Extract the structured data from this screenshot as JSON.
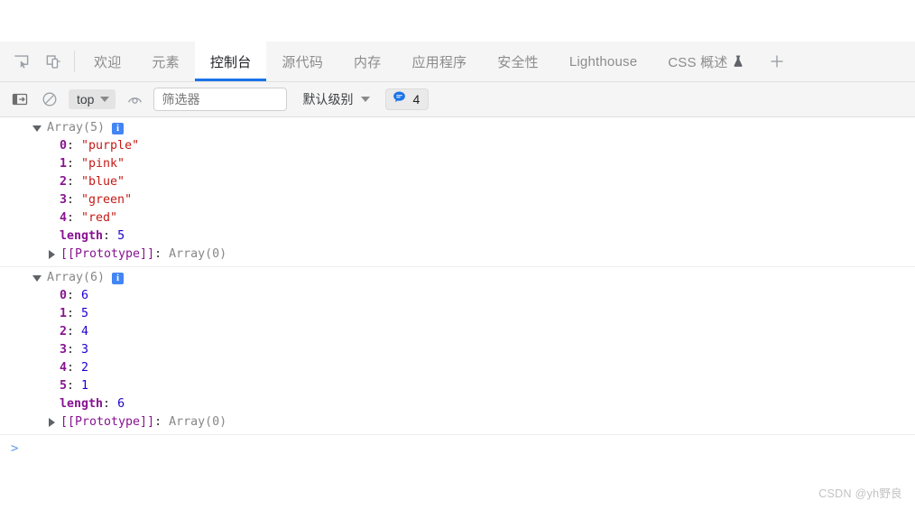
{
  "window": {
    "watermark": "CSDN @yh野良"
  },
  "tabbar": {
    "inspect_icon": "inspect-element-icon",
    "device_icon": "device-toolbar-icon",
    "add_label": "+",
    "tabs": [
      {
        "label": "欢迎",
        "active": false,
        "flask": false
      },
      {
        "label": "元素",
        "active": false,
        "flask": false
      },
      {
        "label": "控制台",
        "active": true,
        "flask": false
      },
      {
        "label": "源代码",
        "active": false,
        "flask": false
      },
      {
        "label": "内存",
        "active": false,
        "flask": false
      },
      {
        "label": "应用程序",
        "active": false,
        "flask": false
      },
      {
        "label": "安全性",
        "active": false,
        "flask": false
      },
      {
        "label": "Lighthouse",
        "active": false,
        "flask": false
      },
      {
        "label": "CSS 概述",
        "active": false,
        "flask": true
      }
    ]
  },
  "console_toolbar": {
    "sidebar_icon": "show-console-sidebar-icon",
    "clear_icon": "clear-console-icon",
    "context": "top",
    "eye_icon": "live-expression-eye-icon",
    "filter_placeholder": "筛选器",
    "filter_value": "",
    "level": "默认级别",
    "message_icon": "message-bubble-icon",
    "message_count": "4"
  },
  "console": {
    "groups": [
      {
        "header": "Array(5)",
        "info_badge": "i",
        "props": [
          {
            "key": "0",
            "value": "\"purple\"",
            "type": "string"
          },
          {
            "key": "1",
            "value": "\"pink\"",
            "type": "string"
          },
          {
            "key": "2",
            "value": "\"blue\"",
            "type": "string"
          },
          {
            "key": "3",
            "value": "\"green\"",
            "type": "string"
          },
          {
            "key": "4",
            "value": "\"red\"",
            "type": "string"
          },
          {
            "key": "length",
            "value": "5",
            "type": "number"
          }
        ],
        "proto_key": "[[Prototype]]",
        "proto_value": "Array(0)"
      },
      {
        "header": "Array(6)",
        "info_badge": "i",
        "props": [
          {
            "key": "0",
            "value": "6",
            "type": "number"
          },
          {
            "key": "1",
            "value": "5",
            "type": "number"
          },
          {
            "key": "2",
            "value": "4",
            "type": "number"
          },
          {
            "key": "3",
            "value": "3",
            "type": "number"
          },
          {
            "key": "4",
            "value": "2",
            "type": "number"
          },
          {
            "key": "5",
            "value": "1",
            "type": "number"
          },
          {
            "key": "length",
            "value": "6",
            "type": "number"
          }
        ],
        "proto_key": "[[Prototype]]",
        "proto_value": "Array(0)"
      }
    ],
    "prompt": ">"
  },
  "colors": {
    "accent": "#1a73e8",
    "key": "#881391",
    "string": "#c41a16",
    "number": "#1c00cf",
    "muted": "#878787",
    "info_badge": "#4285f4"
  }
}
